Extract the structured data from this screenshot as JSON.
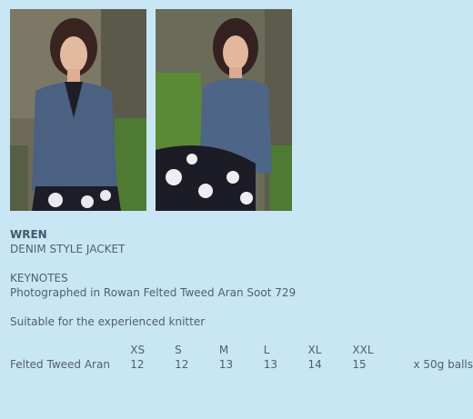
{
  "pattern": {
    "name": "WREN",
    "subtitle": "DENIM STYLE JACKET"
  },
  "keynotes": {
    "heading": "KEYNOTES",
    "line1": "Photographed in Rowan Felted Tweed Aran Soot 729",
    "line2": "Suitable for the experienced knitter"
  },
  "sizes": {
    "headers": [
      "XS",
      "S",
      "M",
      "L",
      "XL",
      "XXL"
    ],
    "yarn": "Felted Tweed Aran",
    "quantities": [
      "12",
      "12",
      "13",
      "13",
      "14",
      "15"
    ],
    "unit": "x 50g balls"
  },
  "colors": {
    "background": "#c9e6f5",
    "text": "#4f6070"
  }
}
